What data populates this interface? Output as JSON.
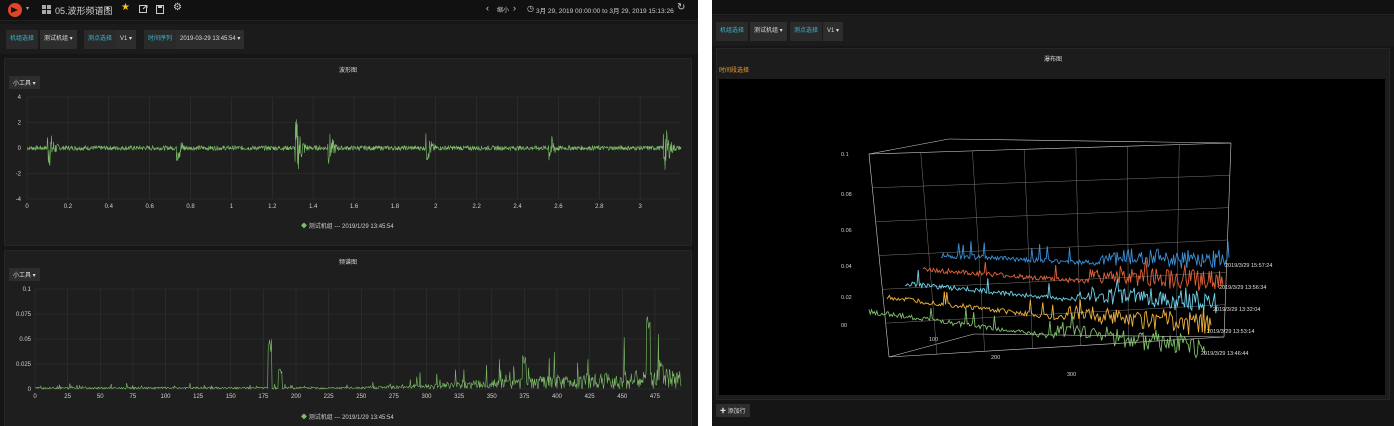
{
  "left": {
    "topbar": {
      "dashboard_title": "05.波形频谱图",
      "zoom_out": "缩小",
      "time_range": "3月 29, 2019 00:00:00 to 3月 29, 2019 15:13:26"
    },
    "variables": {
      "machine_label": "机组选择",
      "machine_value": "测试机组",
      "point_label": "测点选择",
      "point_value": "V1",
      "time_label": "时间序列",
      "time_value": "2019-03-29 13:45:54"
    },
    "waveform": {
      "title": "波形图",
      "tool": "小工具",
      "legend": "测试机组 --- 2019/1/29 13:45:54"
    },
    "spectrum": {
      "title": "频谱图",
      "tool": "小工具",
      "legend": "测试机组 --- 2019/1/29 13:45:54"
    }
  },
  "right": {
    "variables": {
      "machine_label": "机组选择",
      "machine_value": "测试机组",
      "point_label": "测点选择",
      "point_value": "V1"
    },
    "waterfall": {
      "title": "瀑布图",
      "subtitle": "时间段选择",
      "z_ticks": [
        "0.1",
        "0.08",
        "0.06",
        "0.04",
        "0.02",
        "00"
      ],
      "x_ticks": [
        "100",
        "200",
        "300"
      ],
      "series_labels": [
        "2019/3/29 15:57:24",
        "2019/3/29 13:56:34",
        "2019/3/29 13:32:04",
        "2019/3/29 13:53:14",
        "2019/3/29 13:46:44"
      ],
      "add_row": "添加行"
    }
  },
  "colors": {
    "wave": "#7fbf6a",
    "series": [
      "#3a8fd8",
      "#e0623a",
      "#6fd0e8",
      "#f0b23a",
      "#7fbf6a"
    ],
    "accent": "#3fb6d0",
    "star": "#f5c518"
  },
  "chart_data": [
    {
      "type": "line",
      "title": "波形图",
      "x_ticks": [
        "0",
        "0.2",
        "0.4",
        "0.6",
        "0.8",
        "1",
        "1.2",
        "1.4",
        "1.6",
        "1.8",
        "2",
        "2.2",
        "2.4",
        "2.6",
        "2.8",
        "3"
      ],
      "y_ticks": [
        "4",
        "2",
        "0",
        "-2",
        "-4"
      ],
      "xlim": [
        0,
        3.2
      ],
      "ylim": [
        -4,
        4
      ],
      "bursts": [
        {
          "x": 0.11,
          "amp": 1.6
        },
        {
          "x": 0.74,
          "amp": 1.2
        },
        {
          "x": 1.32,
          "amp": 2.4
        },
        {
          "x": 1.48,
          "amp": 1.3
        },
        {
          "x": 1.96,
          "amp": 1.2
        },
        {
          "x": 2.56,
          "amp": 1.3
        },
        {
          "x": 3.12,
          "amp": 2.1
        }
      ],
      "series": [
        {
          "name": "测试机组 --- 2019/1/29 13:45:54"
        }
      ]
    },
    {
      "type": "line",
      "title": "频谱图",
      "x_ticks": [
        "0",
        "25",
        "50",
        "75",
        "100",
        "125",
        "150",
        "175",
        "200",
        "225",
        "250",
        "275",
        "300",
        "325",
        "350",
        "375",
        "400",
        "425",
        "450",
        "475"
      ],
      "y_ticks": [
        "0.1",
        "0.075",
        "0.05",
        "0.025",
        "0"
      ],
      "xlim": [
        0,
        495
      ],
      "ylim": [
        0,
        0.1
      ],
      "peaks": [
        {
          "x": 180,
          "y": 0.052
        },
        {
          "x": 188,
          "y": 0.02
        },
        {
          "x": 375,
          "y": 0.033
        },
        {
          "x": 470,
          "y": 0.078
        },
        {
          "x": 480,
          "y": 0.03
        }
      ],
      "series": [
        {
          "name": "测试机组 --- 2019/1/29 13:45:54"
        }
      ]
    },
    {
      "type": "area",
      "title": "瀑布图",
      "series": [
        {
          "name": "2019/3/29 15:57:24"
        },
        {
          "name": "2019/3/29 13:56:34"
        },
        {
          "name": "2019/3/29 13:32:04"
        },
        {
          "name": "2019/3/29 13:53:14"
        },
        {
          "name": "2019/3/29 13:46:44"
        }
      ]
    }
  ]
}
